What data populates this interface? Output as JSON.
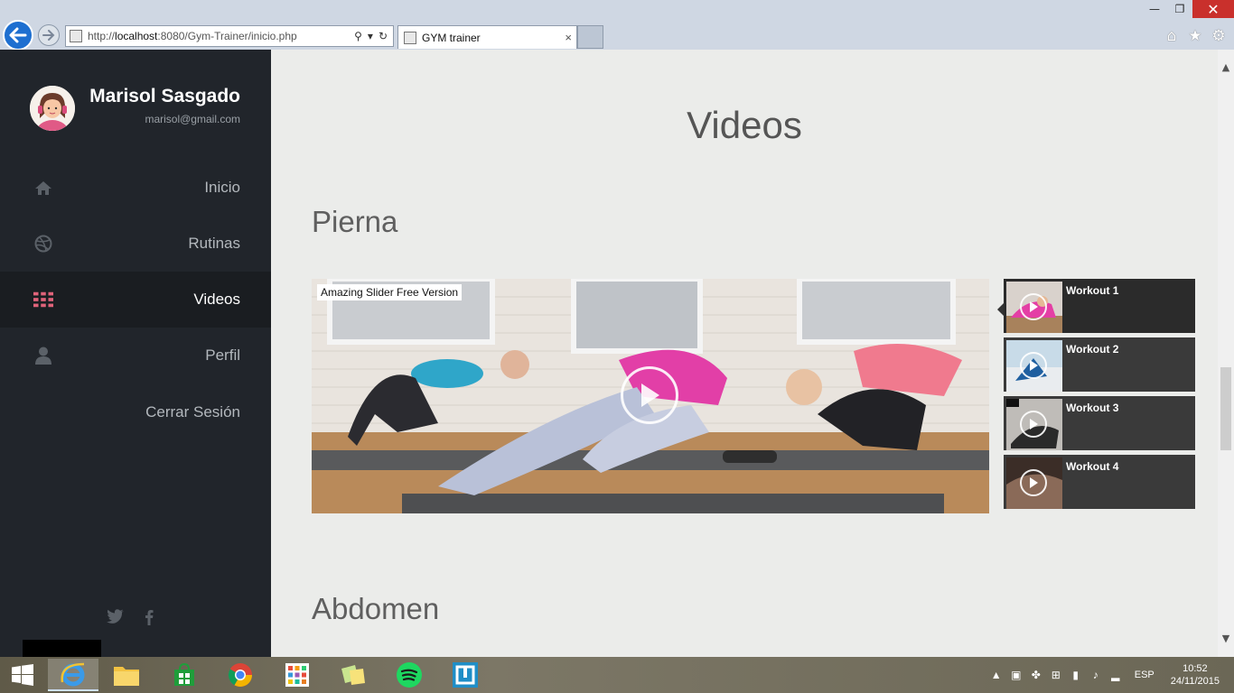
{
  "browser": {
    "url_prefix": "http://",
    "url_host": "localhost",
    "url_rest": ":8080/Gym-Trainer/inicio.php",
    "tab_title": "GYM trainer",
    "tab_close": "×",
    "minimize": "—",
    "restore": "❐",
    "close": "✕"
  },
  "sidebar": {
    "user_name": "Marisol Sasgado",
    "user_email": "marisol@gmail.com",
    "items": [
      {
        "label": "Inicio",
        "icon": "home-icon"
      },
      {
        "label": "Rutinas",
        "icon": "dribbble-icon"
      },
      {
        "label": "Videos",
        "icon": "grid-icon",
        "active": true
      },
      {
        "label": "Perfil",
        "icon": "user-icon"
      },
      {
        "label": "Cerrar Sesión",
        "icon": ""
      }
    ]
  },
  "main": {
    "page_title": "Videos",
    "sections": [
      "Pierna",
      "Abdomen"
    ],
    "slider_label": "Amazing Slider Free Version",
    "thumbs": [
      "Workout 1",
      "Workout 2",
      "Workout 3",
      "Workout 4"
    ]
  },
  "taskbar": {
    "lang": "ESP",
    "time": "10:52",
    "date": "24/11/2015"
  },
  "colors": {
    "sidebar_bg": "#21252b",
    "accent_pink": "#e0637a",
    "ie_blue": "#1e6fd0"
  }
}
